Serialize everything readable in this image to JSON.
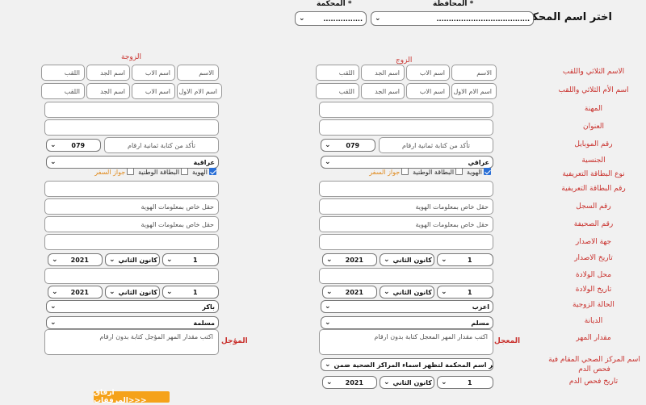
{
  "header": {
    "title": "اختر اسم المحكمة",
    "governorate_label": "* المحافظة",
    "court_label": "* المحكمة",
    "governorate_value": "......................................",
    "court_value": "................"
  },
  "columns": {
    "groom": "الزوج",
    "bride": "الزوجة"
  },
  "row_labels": {
    "full_name": "الاسم الثلاثي واللقب",
    "mother_name": "اسم الأم الثلاثي واللقب",
    "profession": "المهنة",
    "address": "العنوان",
    "mobile": "رقم الموبايل",
    "nationality": "الجنسية",
    "id_type": "نوع البطاقة التعريفية",
    "id_number": "رقم البطاقة التعريفية",
    "record_number": "رقم السجل",
    "page_number": "رقم الصحيفة",
    "issuing_authority": "جهة الاصدار",
    "issue_date": "تاريخ الاصدار",
    "birth_place": "محل الولادة",
    "birth_date": "تاريخ الولادة",
    "marital_status": "الحالة الزوجية",
    "religion": "الديانة",
    "dowry_amount": "مقدار المهر",
    "health_center": "اسم المركز الصحي المقام فية فحص الدم",
    "blood_test_date": "تاريخ فحص الدم"
  },
  "placeholders": {
    "name": "الاسم",
    "father": "اسم الاب",
    "grandfather": "اسم الجد",
    "surname": "اللقب",
    "mother_first": "اسم الام الاول",
    "mobile_hint": "تأكد من كتابة ثمانية ارقام",
    "id_field": "حقل خاص بمعلومات الهوية",
    "advance_dowry": "اكتب مقدار المهر المعجل كتابة بدون ارقام",
    "deferred_dowry": "اكتب مقدار المهر المؤجل كتابة بدون ارقام"
  },
  "id_types": {
    "national_id": "الهوية",
    "national_card": "البطاقة الوطنية",
    "passport": "جواز السفر"
  },
  "groom": {
    "mobile_prefix": "079",
    "nationality": "عراقي",
    "issue_day": "1",
    "issue_month": "كانون الثاني",
    "issue_year": "2021",
    "birth_day": "1",
    "birth_month": "كانون الثاني",
    "birth_year": "2021",
    "marital_status": "اعزب",
    "religion": "مسلم",
    "dowry_label": "المعجل",
    "health_center": "اختر اسم المحكمة لتظهر اسماء المراكز الصحية ضمن ...",
    "blood_day": "1",
    "blood_month": "كانون الثاني",
    "blood_year": "2021"
  },
  "bride": {
    "mobile_prefix": "079",
    "nationality": "عراقية",
    "issue_day": "1",
    "issue_month": "كانون الثاني",
    "issue_year": "2021",
    "birth_day": "1",
    "birth_month": "كانون الثاني",
    "birth_year": "2021",
    "marital_status": "باكر",
    "religion": "مسلمة",
    "dowry_label": "المؤجل"
  },
  "attach_button": "ارفاق المرفقات>>>",
  "colors": {
    "label_red": "#c9302c",
    "button_orange": "#f5a21a",
    "checkbox_blue": "#2a6fd6"
  }
}
